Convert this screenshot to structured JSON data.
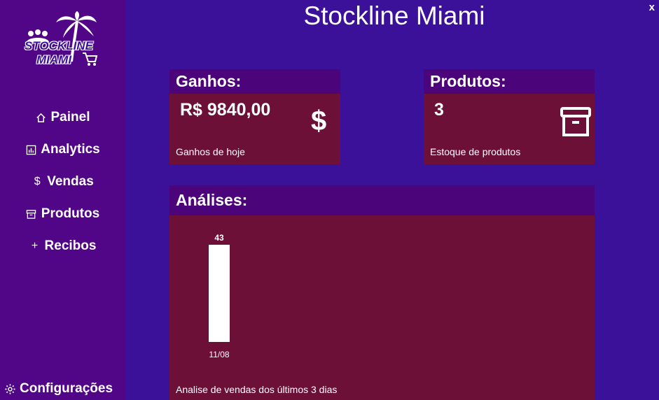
{
  "app": {
    "title": "Stockline Miami",
    "close_label": "x"
  },
  "sidebar": {
    "logo": {
      "line1": "STOCKLINE",
      "line2": "MIAMI"
    },
    "items": [
      {
        "label": "Painel",
        "icon": "home-icon"
      },
      {
        "label": "Analytics",
        "icon": "chart-icon"
      },
      {
        "label": "Vendas",
        "icon": "dollar-icon"
      },
      {
        "label": "Produtos",
        "icon": "archive-icon"
      },
      {
        "label": "Recibos",
        "icon": "plus-icon"
      }
    ],
    "settings": {
      "label": "Configurações",
      "icon": "gear-icon"
    }
  },
  "cards": {
    "earnings": {
      "title": "Ganhos:",
      "value": "R$ 9840,00",
      "caption": "Ganhos de hoje",
      "icon": "dollar-icon"
    },
    "products": {
      "title": "Produtos:",
      "value": "3",
      "caption": "Estoque de produtos",
      "icon": "archive-icon"
    }
  },
  "analytics": {
    "title": "Análises:",
    "caption": "Analise de vendas dos últimos 3 dias"
  },
  "colors": {
    "background": "#3a1198",
    "sidebar": "#510688",
    "card_header": "#4c047a",
    "card_body": "#6c1038",
    "bar": "#ffffff"
  },
  "chart_data": {
    "type": "bar",
    "categories": [
      "11/08"
    ],
    "values": [
      43
    ],
    "title": "",
    "xlabel": "",
    "ylabel": "",
    "ylim": [
      0,
      43
    ],
    "grid": false
  }
}
